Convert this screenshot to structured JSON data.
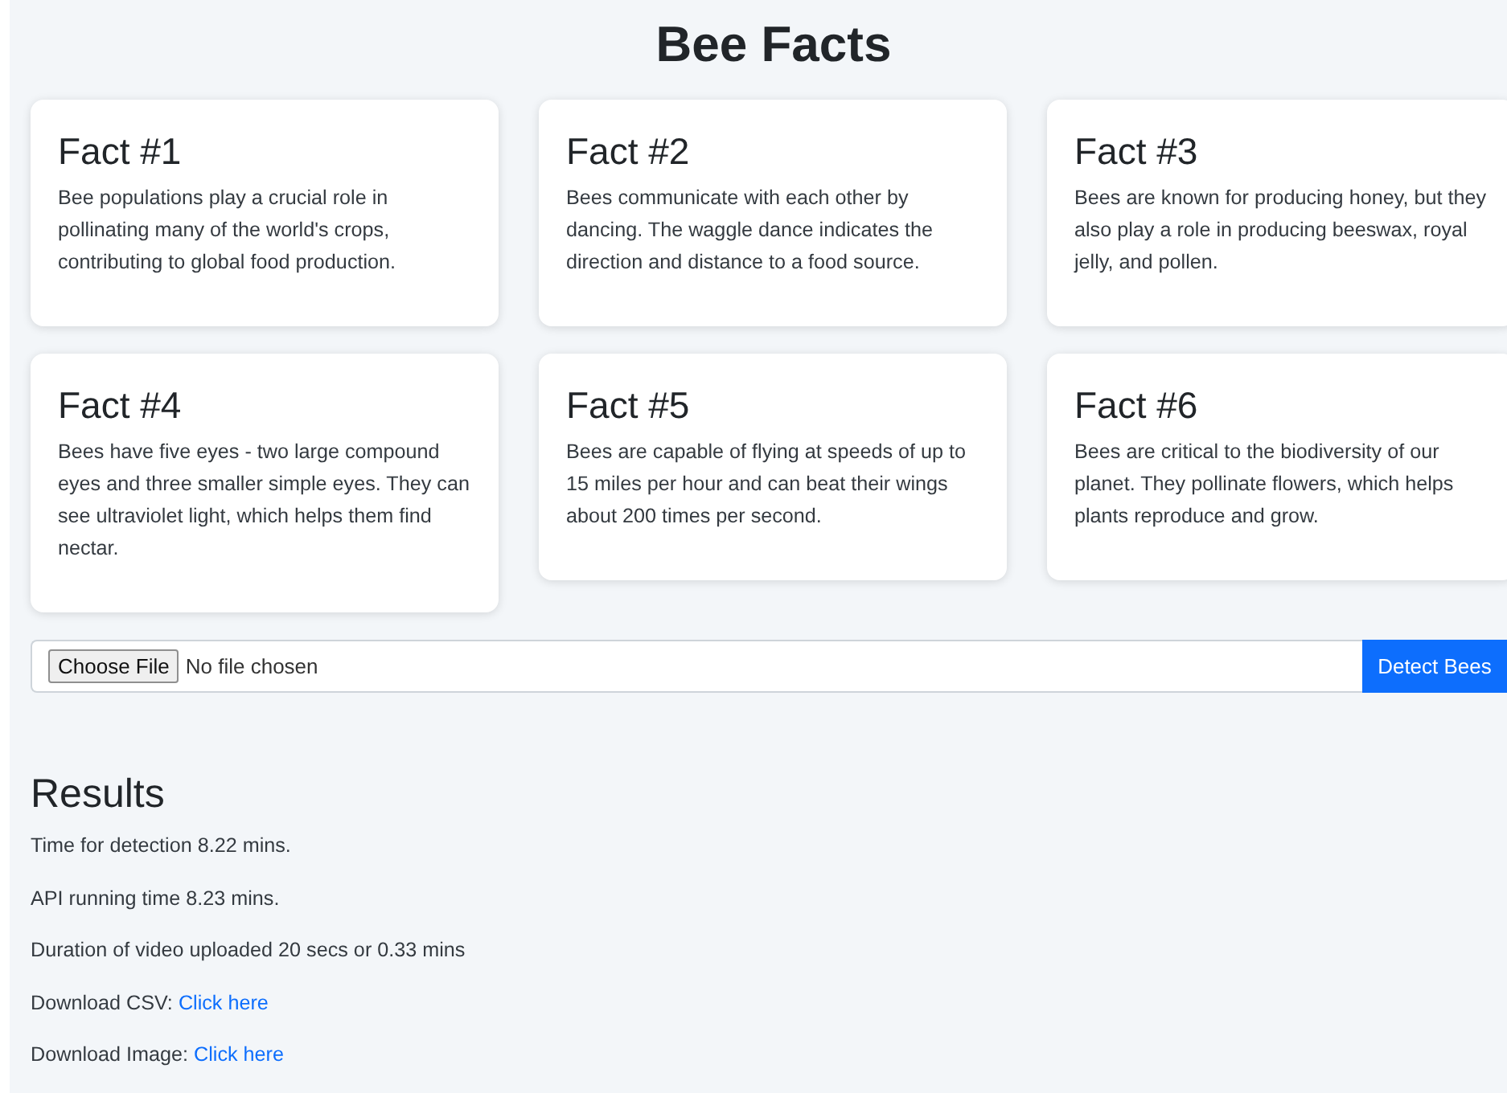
{
  "title": "Bee Facts",
  "facts": [
    {
      "heading": "Fact #1",
      "text": "Bee populations play a crucial role in pollinating many of the world's crops, contributing to global food production."
    },
    {
      "heading": "Fact #2",
      "text": "Bees communicate with each other by dancing. The waggle dance indicates the direction and distance to a food source."
    },
    {
      "heading": "Fact #3",
      "text": "Bees are known for producing honey, but they also play a role in producing beeswax, royal jelly, and pollen."
    },
    {
      "heading": "Fact #4",
      "text": "Bees have five eyes - two large compound eyes and three smaller simple eyes. They can see ultraviolet light, which helps them find nectar."
    },
    {
      "heading": "Fact #5",
      "text": "Bees are capable of flying at speeds of up to 15 miles per hour and can beat their wings about 200 times per second."
    },
    {
      "heading": "Fact #6",
      "text": "Bees are critical to the biodiversity of our planet. They pollinate flowers, which helps plants reproduce and grow."
    }
  ],
  "upload": {
    "choose_label": "Choose File",
    "status": "No file chosen",
    "button": "Detect Bees"
  },
  "results": {
    "heading": "Results",
    "lines": [
      {
        "text": "Time for detection 8.22 mins."
      },
      {
        "text": "API running time 8.23 mins."
      },
      {
        "text": "Duration of video uploaded 20 secs or 0.33 mins"
      },
      {
        "text": "Download CSV:",
        "link": "Click here"
      },
      {
        "text": "Download Image:",
        "link": "Click here"
      }
    ]
  }
}
